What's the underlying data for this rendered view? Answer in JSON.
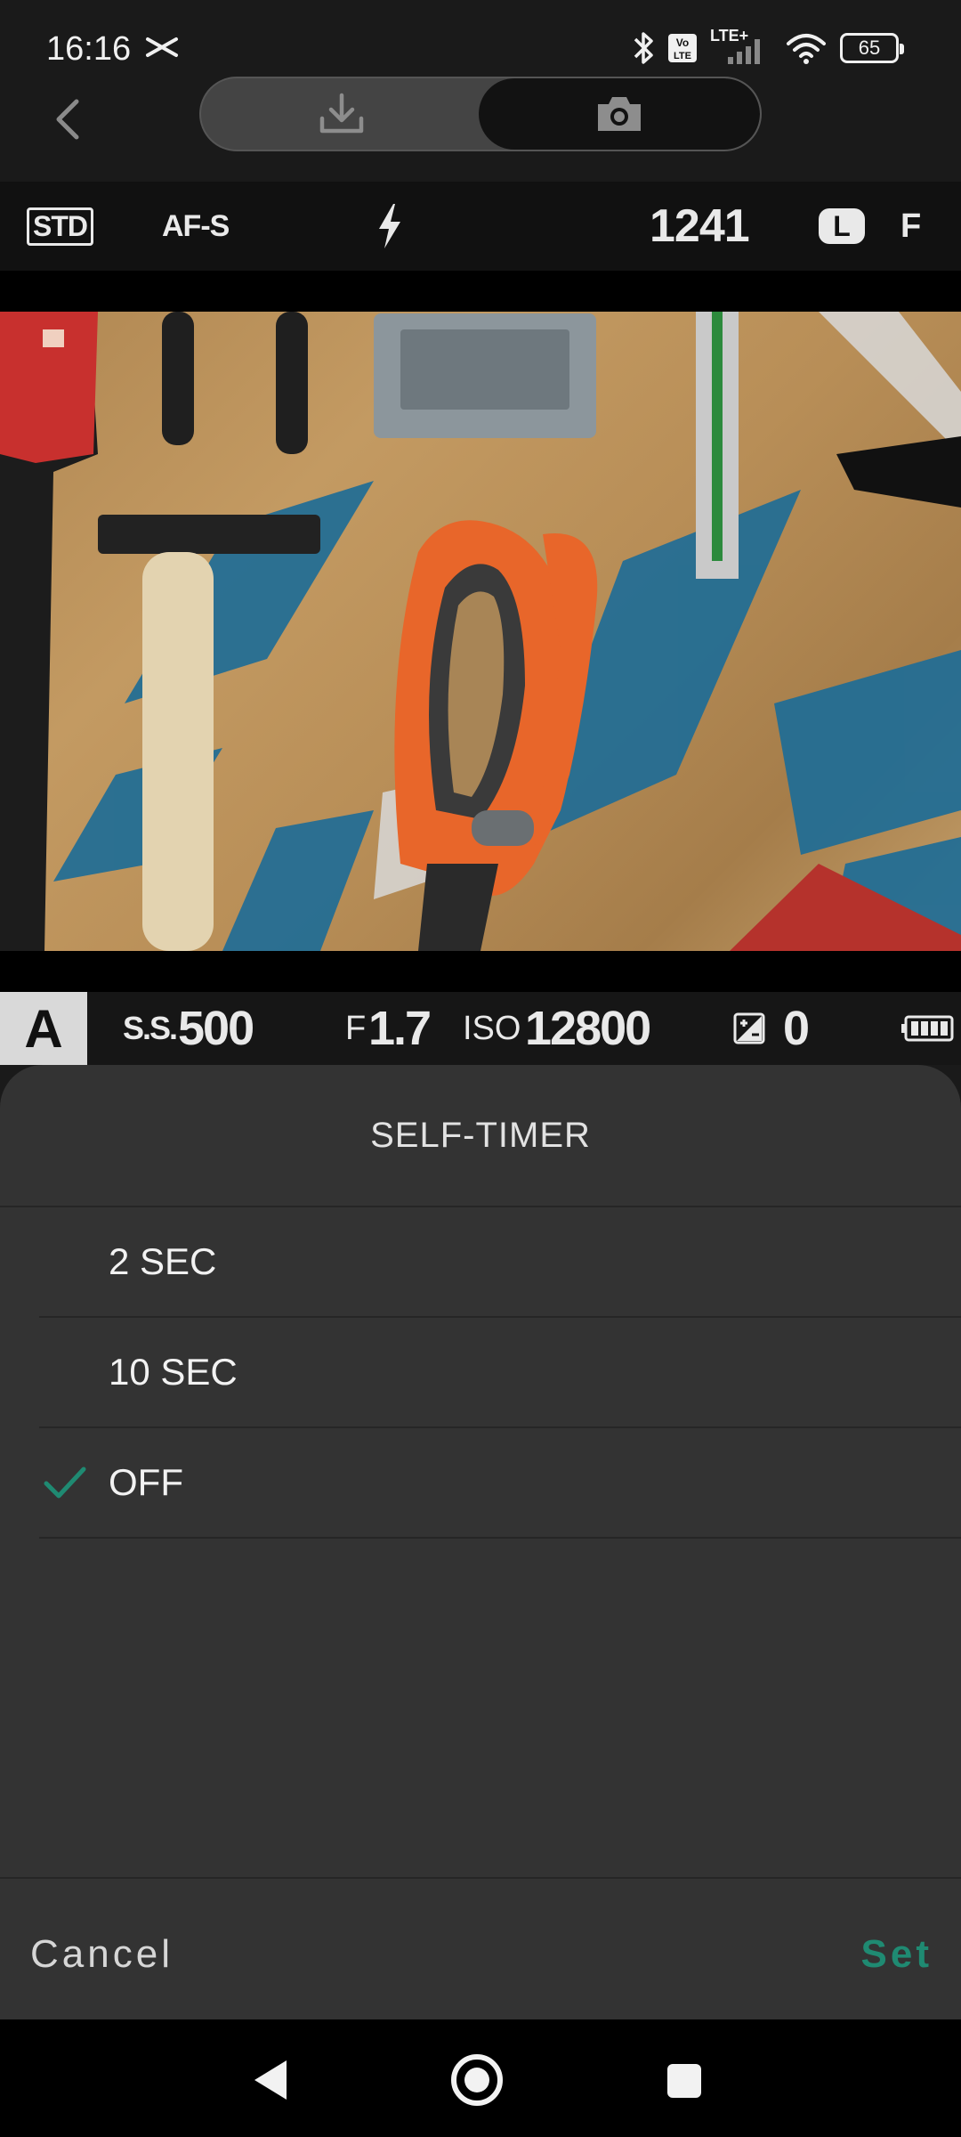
{
  "status_bar": {
    "time": "16:16",
    "network_label": "LTE+",
    "volte_label": "Vo LTE",
    "battery_level": "65"
  },
  "top_nav": {
    "icons": [
      "back-arrow-icon",
      "download-icon",
      "camera-icon"
    ],
    "active_mode": "camera"
  },
  "camera_info": {
    "film_sim": "STD",
    "focus_mode": "AF-S",
    "flash_icon": "flash-icon",
    "shots_remaining": "1241",
    "image_size": "L",
    "image_quality": "F"
  },
  "exposure": {
    "mode": "A",
    "shutter_label": "S.S.",
    "shutter_value": "500",
    "aperture_label": "F",
    "aperture_value": "1.7",
    "iso_label": "ISO",
    "iso_value": "12800",
    "ev_value": "0",
    "battery_icon": "camera-battery-icon"
  },
  "self_timer_sheet": {
    "title": "SELF-TIMER",
    "options": [
      {
        "label": "2 SEC",
        "selected": false
      },
      {
        "label": "10 SEC",
        "selected": false
      },
      {
        "label": "OFF",
        "selected": true
      }
    ],
    "cancel_label": "Cancel",
    "set_label": "Set",
    "accent_color": "#1f8a72"
  },
  "system_nav": {
    "icons": [
      "back-triangle-icon",
      "home-circle-icon",
      "recents-square-icon"
    ]
  }
}
